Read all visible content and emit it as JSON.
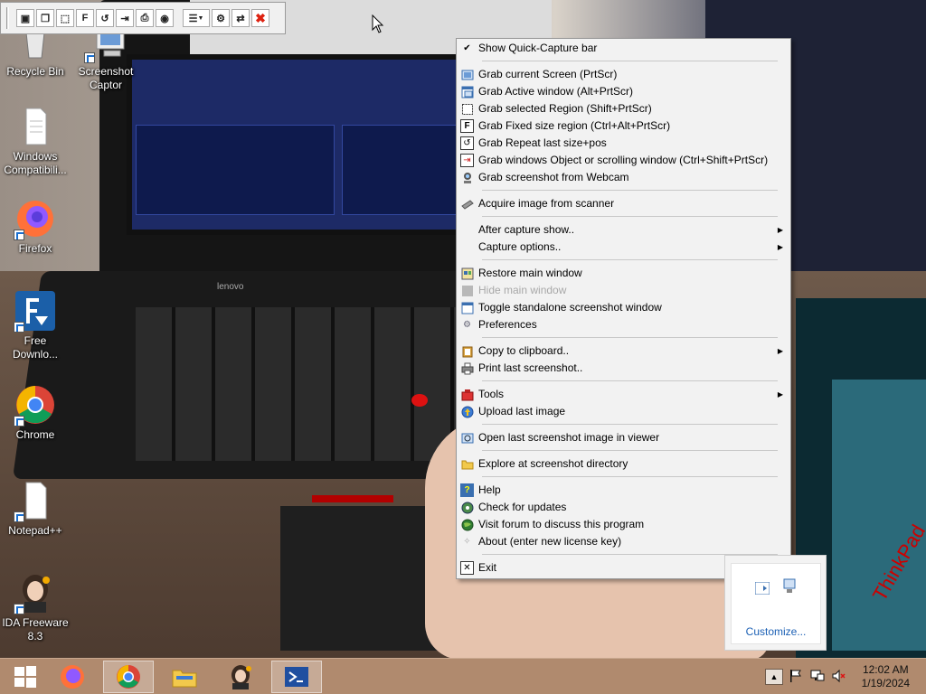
{
  "desktop": {
    "icons": [
      {
        "label": "Recycle Bin"
      },
      {
        "label": "Screenshot Captor"
      },
      {
        "label": "Windows Compatibili..."
      },
      {
        "label": "Firefox"
      },
      {
        "label": "Free Downlo..."
      },
      {
        "label": "Chrome"
      },
      {
        "label": "Notepad++"
      },
      {
        "label": "IDA Freeware 8.3"
      }
    ]
  },
  "quick_capture_bar": {
    "buttons": [
      {
        "icon": "screen-icon",
        "glyph": "▣"
      },
      {
        "icon": "window-icon",
        "glyph": "❐"
      },
      {
        "icon": "region-icon",
        "glyph": "⬚"
      },
      {
        "icon": "fixed-region-icon",
        "glyph": "F"
      },
      {
        "icon": "repeat-icon",
        "glyph": "↺"
      },
      {
        "icon": "object-icon",
        "glyph": "⇥"
      },
      {
        "icon": "scanner-icon",
        "glyph": "⎙"
      },
      {
        "icon": "webcam-icon",
        "glyph": "◉"
      },
      {
        "icon": "options-icon",
        "glyph": "☰"
      },
      {
        "icon": "gear-icon",
        "glyph": "⚙"
      },
      {
        "icon": "arrows-icon",
        "glyph": "⇄"
      },
      {
        "icon": "close-icon",
        "glyph": "✖"
      }
    ]
  },
  "menu": {
    "show_quick_capture": "Show Quick-Capture bar",
    "grab_current_screen": "Grab current Screen (PrtScr)",
    "grab_active_window": "Grab Active window (Alt+PrtScr)",
    "grab_selected_region": "Grab selected Region (Shift+PrtScr)",
    "grab_fixed_region": "Grab Fixed size region (Ctrl+Alt+PrtScr)",
    "grab_repeat": "Grab Repeat last size+pos",
    "grab_windows_object": "Grab windows Object or scrolling window (Ctrl+Shift+PrtScr)",
    "grab_webcam": "Grab screenshot from Webcam",
    "acquire_scanner": "Acquire image from scanner",
    "after_capture": "After capture show..",
    "capture_options": "Capture options..",
    "restore_main": "Restore main window",
    "hide_main": "Hide main window",
    "toggle_standalone": "Toggle standalone screenshot window",
    "preferences": "Preferences",
    "copy_clipboard": "Copy to clipboard..",
    "print_last": "Print last screenshot..",
    "tools": "Tools",
    "upload_last": "Upload last image",
    "open_last": "Open last screenshot image in viewer",
    "explore_dir": "Explore at screenshot directory",
    "help": "Help",
    "check_updates": "Check for updates",
    "visit_forum": "Visit forum to discuss this program",
    "about": "About (enter new license key)",
    "exit": "Exit"
  },
  "overflow": {
    "customize": "Customize..."
  },
  "taskbar": {
    "clock_time": "12:02 AM",
    "clock_date": "1/19/2024"
  },
  "background_text": {
    "lenovo": "lenovo",
    "thinkpad": "ThinkPad"
  },
  "colors": {
    "menu_bg": "#f2f2f2",
    "taskbar": "#b08a6e",
    "link": "#1a5fb4"
  }
}
